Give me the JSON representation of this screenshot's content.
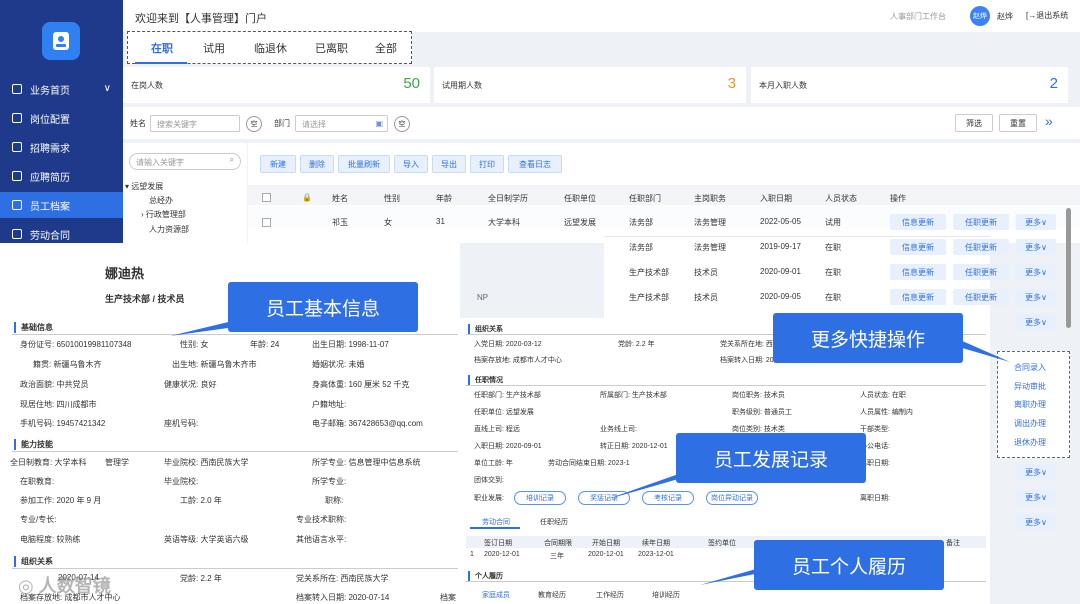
{
  "sidebar": {
    "items": [
      {
        "label": "业务首页",
        "icon": "cube-icon"
      },
      {
        "label": "岗位配置",
        "icon": "building-icon"
      },
      {
        "label": "招聘需求",
        "icon": "document-icon"
      },
      {
        "label": "应聘简历",
        "icon": "briefcase-icon"
      },
      {
        "label": "员工档案",
        "icon": "grid-icon"
      },
      {
        "label": "劳动合同",
        "icon": "contract-icon"
      }
    ]
  },
  "header": {
    "welcome": "欢迎来到【人事管理】门户",
    "portal": "人事部门工作台",
    "avatar": "赵烨",
    "user": "赵烨",
    "logout": "退出系统"
  },
  "tabs": [
    "在职",
    "试用",
    "临退休",
    "已离职",
    "全部"
  ],
  "stats": [
    {
      "label": "在岗人数",
      "value": "50",
      "color": "#3aa84a"
    },
    {
      "label": "试用期人数",
      "value": "3",
      "color": "#f0932b"
    },
    {
      "label": "本月入职人数",
      "value": "2",
      "color": "#2f6fe4"
    }
  ],
  "filter": {
    "name_label": "姓名",
    "name_placeholder": "搜索关键字",
    "empty1": "空",
    "dept_label": "部门",
    "dept_placeholder": "请选择",
    "empty2": "空",
    "filter_btn": "筛选",
    "reset_btn": "重置",
    "expand": "»"
  },
  "tree": {
    "search_placeholder": "请输入关键字",
    "nodes": [
      "远望发展",
      "总经办",
      "行政管理部",
      "人力资源部"
    ]
  },
  "toolbar": [
    "新建",
    "删除",
    "批量刷新",
    "导入",
    "导出",
    "打印",
    "查看日志"
  ],
  "table": {
    "headers": [
      "姓名",
      "性别",
      "年龄",
      "全日制学历",
      "任职单位",
      "任职部门",
      "主岗职务",
      "入职日期",
      "人员状态",
      "操作"
    ],
    "rows": [
      [
        "祁玉",
        "女",
        "31",
        "大学本科",
        "远望发展",
        "法务部",
        "法务管理",
        "2022-05-05",
        "试用"
      ],
      [
        "",
        "",
        "",
        "",
        "",
        "法务部",
        "法务管理",
        "2019-09-17",
        "在职"
      ],
      [
        "",
        "",
        "",
        "",
        "",
        "生产技术部",
        "技术员",
        "2020-09-01",
        "在职"
      ],
      [
        "",
        "",
        "",
        "",
        "",
        "生产技术部",
        "技术员",
        "2020-09-05",
        "在职"
      ]
    ],
    "row_action1": "信息更新",
    "row_action2": "任职更新",
    "row_more": "更多∨",
    "np": "NP"
  },
  "profile": {
    "name": "娜迪热",
    "dept_title": "生产技术部 / 技术员",
    "sec_basic": "基础信息",
    "id_no": "身份证号: 650100199811073​48",
    "gender": "性别: 女",
    "age_k": "年龄:",
    "age": "24",
    "birth": "出生日期: 1998-11-07",
    "native": "籍贯: 新疆乌鲁木齐",
    "birthplace": "出生地: 新疆乌鲁木齐市",
    "marital": "婚姻状况: 未婚",
    "politics": "政治面貌: 中共党员",
    "health": "健康状况: 良好",
    "height_k": "身高体重:",
    "height": "160 厘米",
    "weight": "52 千克",
    "residence": "现居住地: 四川成都市",
    "hukou": "户籍地址:",
    "phone": "手机号码: 19457421342",
    "landline": "座机号码:",
    "email": "电子邮箱: 367428653@qq.com",
    "sec_ability": "能力技能",
    "edu": "全日制教育: 大学本科",
    "major": "管理学",
    "school": "毕业院校: 西南民族大学",
    "major2": "所学专业: 信息管理中信息系统",
    "inservice_edu": "在职教育:",
    "school2": "毕业院校:",
    "major3": "所学专业:",
    "work_start": "参加工作: 2020 年 9 月",
    "seniority_k": "工龄:",
    "seniority": "2.0 年",
    "title": "职称:",
    "specialty": "专业/专长:",
    "pro_title": "专业技术职称:",
    "computer": "电脑程度: 较熟练",
    "english": "英语等级: 大学英语六级",
    "other_lang": "其他语言水平:",
    "sec_org": "组织关系",
    "join_date": "2020-07-14",
    "party_age_k": "党龄:",
    "party_age": "2.2 年",
    "party_org": "党关系所在: 西南民族大学",
    "archive": "档案存放地: 成都市人才中心",
    "archive_date": "档案转入日期: 2020-07-14",
    "archive_more": "档案"
  },
  "records": {
    "sec_org": "组织关系",
    "entry_date": "入党日期: 2020-03-12",
    "party_age": "党龄:",
    "party_age_v": "2.2 年",
    "party_org": "党关系所在地: 西",
    "archive": "档案存放地: 成都市人才中心",
    "archive_date": "档案转入日期: 20",
    "sec_job": "任职情况",
    "dept": "任职部门: 生产技术部",
    "dept2": "所属部门: 生产技术部",
    "post": "岗位职务: 技术员",
    "status": "人员状态: 在职",
    "unit": "任职单位: 远望发展",
    "level": "职务级别: 普通员工",
    "type": "人员属性: 编制内",
    "line": "直线上司: 程远",
    "biz_line": "业务线上司:",
    "post_type": "岗位类别: 技术类",
    "cadre": "干部类型:",
    "entry": "入职日期: 2020-09-01",
    "regular": "转正日期: 2020-12-01",
    "office": "办公电话:",
    "unit_seniority": "单位工龄:",
    "unit_seniority_v": "年",
    "contract_end": "劳动合同结束日期: 2023-1",
    "leave": "离职日期:",
    "fringe": "团体交到:",
    "career": "职业发展:",
    "btns": [
      "培训记录",
      "奖惩记录",
      "考核记录",
      "岗位异动记录"
    ],
    "leave_date": "离职日期:",
    "subtabs": [
      "劳动合同",
      "任职经历"
    ],
    "contract_headers": [
      "签订日期",
      "合同期限",
      "开始日期",
      "续年日期",
      "签约单位",
      "备注"
    ],
    "contract_row": [
      "1",
      "2020-12-01",
      "三年",
      "2020-12-01",
      "2023-12-01"
    ],
    "sec_resume": "个人履历",
    "resume_tabs": [
      "家庭成员",
      "教育经历",
      "工作经历",
      "培训经历"
    ]
  },
  "callouts": {
    "basic": "员工基本信息",
    "quick": "更多快捷操作",
    "develop": "员工发展记录",
    "resume": "员工个人履历"
  },
  "quick_menu": [
    "合同录入",
    "异动审批",
    "离职办理",
    "调出办理",
    "退休办理"
  ],
  "watermark": "人数智镜"
}
